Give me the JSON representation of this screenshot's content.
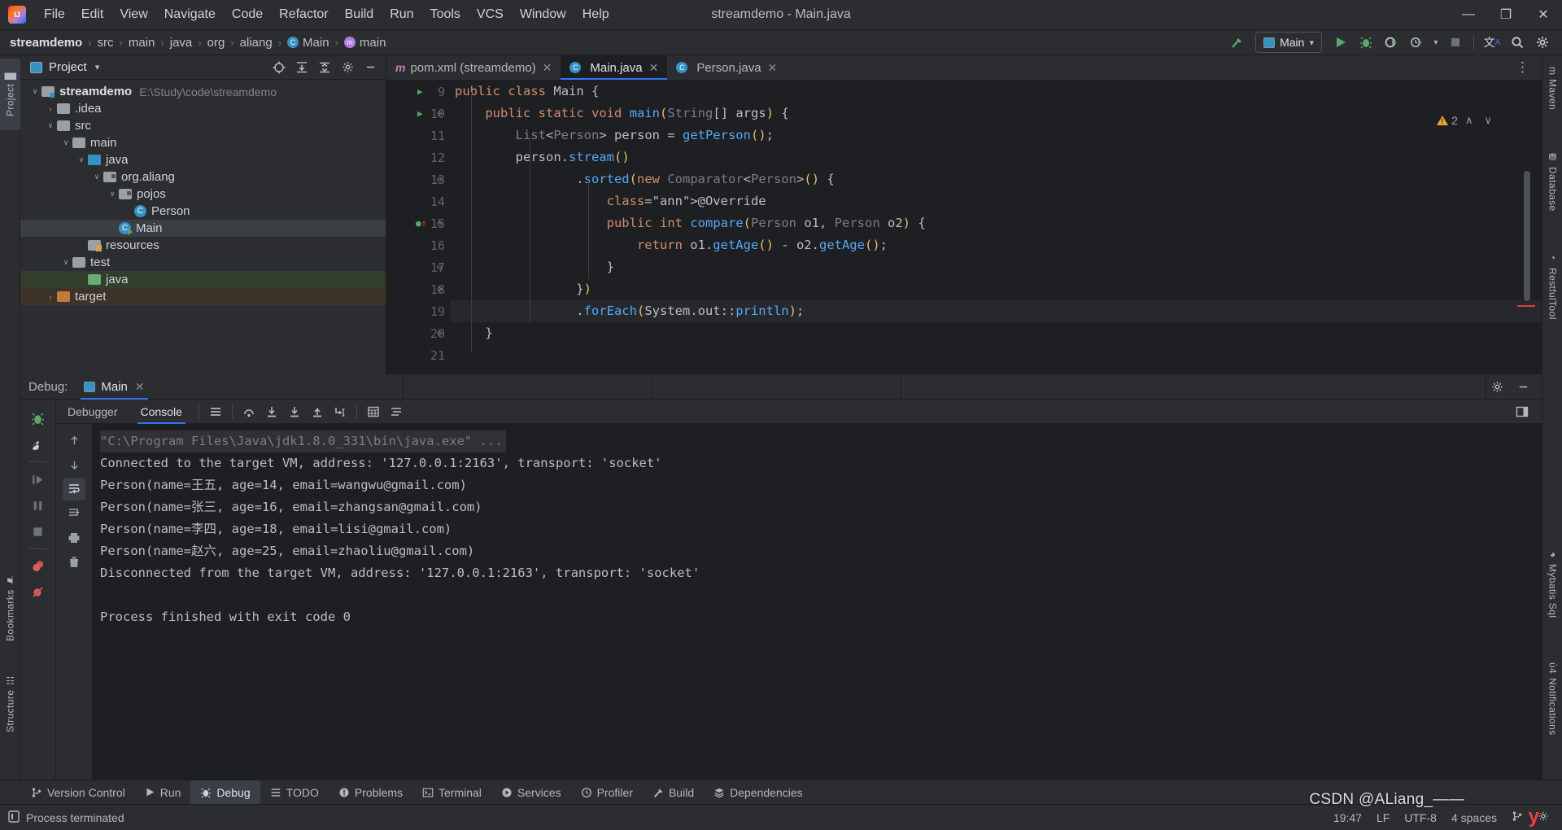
{
  "titlebar": {
    "logo_icon": "intellij-idea-logo",
    "window_title": "streamdemo - Main.java",
    "menus": [
      {
        "label": "File"
      },
      {
        "label": "Edit"
      },
      {
        "label": "View"
      },
      {
        "label": "Navigate"
      },
      {
        "label": "Code"
      },
      {
        "label": "Refactor"
      },
      {
        "label": "Build"
      },
      {
        "label": "Run"
      },
      {
        "label": "Tools"
      },
      {
        "label": "VCS"
      },
      {
        "label": "Window"
      },
      {
        "label": "Help"
      }
    ],
    "window_controls": {
      "minimize": "—",
      "maximize": "❐",
      "close": "✕"
    }
  },
  "navbar": {
    "breadcrumbs": [
      {
        "label": "streamdemo",
        "icon": null
      },
      {
        "label": "src",
        "icon": null
      },
      {
        "label": "main",
        "icon": null
      },
      {
        "label": "java",
        "icon": null
      },
      {
        "label": "org",
        "icon": null
      },
      {
        "label": "aliang",
        "icon": null
      },
      {
        "label": "Main",
        "icon": "class-icon"
      },
      {
        "label": "main",
        "icon": "method-icon"
      }
    ],
    "separator": "›",
    "run_config": {
      "label": "Main",
      "icon": "run-config-icon",
      "chevron": "▾"
    },
    "actions": [
      {
        "name": "build-hammer-icon",
        "glyph": "⬉"
      },
      {
        "name": "run-button",
        "glyph": "▶"
      },
      {
        "name": "debug-button",
        "glyph": "☢"
      },
      {
        "name": "run-with-coverage-button",
        "glyph": "◑"
      },
      {
        "name": "profiler-button",
        "glyph": "⏱"
      },
      {
        "name": "dropdown-chevron-icon",
        "glyph": "▾"
      },
      {
        "name": "stop-button",
        "glyph": "■"
      },
      {
        "name": "translate-icon",
        "glyph": "文"
      },
      {
        "name": "search-everywhere-icon",
        "glyph": "⚲"
      },
      {
        "name": "settings-gear-icon",
        "glyph": "⚙"
      }
    ]
  },
  "left_strip": [
    {
      "label": "Project",
      "glyph": "█",
      "active": true
    },
    {
      "label": "Bookmarks",
      "glyph": "⚑",
      "active": false
    },
    {
      "label": "Structure",
      "glyph": "☷",
      "active": false
    }
  ],
  "right_strip": [
    {
      "label": "Maven",
      "glyph": "m"
    },
    {
      "label": "Database",
      "glyph": "⛃"
    },
    {
      "label": "RestfulTool",
      "glyph": "◔"
    },
    {
      "label": "Mybatis Sql",
      "glyph": "◕"
    },
    {
      "label": "Notifications",
      "glyph": "ὑ4"
    }
  ],
  "project_panel": {
    "title": "Project",
    "dropdown_chevron": "▾",
    "actions": [
      {
        "name": "select-opened-file-icon",
        "glyph": "⌖"
      },
      {
        "name": "expand-all-icon",
        "glyph": "⩛"
      },
      {
        "name": "collapse-all-icon",
        "glyph": "⩚"
      },
      {
        "name": "panel-settings-icon",
        "glyph": "⚙"
      },
      {
        "name": "hide-panel-icon",
        "glyph": "—"
      }
    ],
    "tree": [
      {
        "depth": 0,
        "arrow": "∨",
        "icon": "module-folder-icon",
        "label": "streamdemo",
        "bold": true,
        "path": "E:\\Study\\code\\streamdemo",
        "state": "normal"
      },
      {
        "depth": 1,
        "arrow": "›",
        "icon": "folder-icon",
        "label": ".idea",
        "bold": false,
        "path": "",
        "state": "normal"
      },
      {
        "depth": 1,
        "arrow": "∨",
        "icon": "folder-icon",
        "label": "src",
        "bold": false,
        "path": "",
        "state": "normal"
      },
      {
        "depth": 2,
        "arrow": "∨",
        "icon": "folder-icon",
        "label": "main",
        "bold": false,
        "path": "",
        "state": "normal"
      },
      {
        "depth": 3,
        "arrow": "∨",
        "icon": "source-folder-icon",
        "label": "java",
        "bold": false,
        "path": "",
        "state": "normal"
      },
      {
        "depth": 4,
        "arrow": "∨",
        "icon": "package-icon",
        "label": "org.aliang",
        "bold": false,
        "path": "",
        "state": "normal"
      },
      {
        "depth": 5,
        "arrow": "∨",
        "icon": "package-icon",
        "label": "pojos",
        "bold": false,
        "path": "",
        "state": "normal"
      },
      {
        "depth": 6,
        "arrow": "",
        "icon": "class-icon",
        "label": "Person",
        "bold": false,
        "path": "",
        "state": "normal"
      },
      {
        "depth": 5,
        "arrow": "",
        "icon": "runnable-class-icon",
        "label": "Main",
        "bold": false,
        "path": "",
        "state": "selected"
      },
      {
        "depth": 3,
        "arrow": "",
        "icon": "resources-folder-icon",
        "label": "resources",
        "bold": false,
        "path": "",
        "state": "normal"
      },
      {
        "depth": 2,
        "arrow": "∨",
        "icon": "folder-icon",
        "label": "test",
        "bold": false,
        "path": "",
        "state": "normal"
      },
      {
        "depth": 3,
        "arrow": "",
        "icon": "test-source-folder-icon",
        "label": "java",
        "bold": false,
        "path": "",
        "state": "test"
      },
      {
        "depth": 1,
        "arrow": "›",
        "icon": "excluded-folder-icon",
        "label": "target",
        "bold": false,
        "path": "",
        "state": "excluded"
      }
    ]
  },
  "editor": {
    "tabs": [
      {
        "label": "pom.xml (streamdemo)",
        "icon": "maven-icon",
        "active": false,
        "close": "✕"
      },
      {
        "label": "Main.java",
        "icon": "class-icon",
        "active": true,
        "close": "✕"
      },
      {
        "label": "Person.java",
        "icon": "class-icon",
        "active": false,
        "close": "✕"
      }
    ],
    "kebab_icon": "⋮",
    "warning_count": "2",
    "warning_up_chevron": "∧",
    "warning_down_chevron": "∨",
    "first_line_number": 9,
    "current_line": 19,
    "lines": [
      {
        "num": 9,
        "text": "public class Main {",
        "gutter_run": "▶",
        "gutter_fold": "",
        "gutter_mark": ""
      },
      {
        "num": 10,
        "text": "    public static void main(String[] args) {",
        "gutter_run": "▶",
        "gutter_fold": "⊖",
        "gutter_mark": ""
      },
      {
        "num": 11,
        "text": "        List<Person> person = getPerson();",
        "gutter_run": "",
        "gutter_fold": "",
        "gutter_mark": ""
      },
      {
        "num": 12,
        "text": "        person.stream()",
        "gutter_run": "",
        "gutter_fold": "",
        "gutter_mark": ""
      },
      {
        "num": 13,
        "text": "                .sorted(new Comparator<Person>() {",
        "gutter_run": "",
        "gutter_fold": "⊖",
        "gutter_mark": ""
      },
      {
        "num": 14,
        "text": "                    @Override",
        "gutter_run": "",
        "gutter_fold": "",
        "gutter_mark": ""
      },
      {
        "num": 15,
        "text": "                    public int compare(Person o1, Person o2) {",
        "gutter_run": "",
        "gutter_fold": "⊖",
        "gutter_mark": "override-marker"
      },
      {
        "num": 16,
        "text": "                        return o1.getAge() - o2.getAge();",
        "gutter_run": "",
        "gutter_fold": "",
        "gutter_mark": ""
      },
      {
        "num": 17,
        "text": "                    }",
        "gutter_run": "",
        "gutter_fold": "⊖",
        "gutter_mark": ""
      },
      {
        "num": 18,
        "text": "                })",
        "gutter_run": "",
        "gutter_fold": "⊖",
        "gutter_mark": ""
      },
      {
        "num": 19,
        "text": "                .forEach(System.out::println);",
        "gutter_run": "",
        "gutter_fold": "",
        "gutter_mark": ""
      },
      {
        "num": 20,
        "text": "    }",
        "gutter_run": "",
        "gutter_fold": "⊖",
        "gutter_mark": ""
      },
      {
        "num": 21,
        "text": "",
        "gutter_run": "",
        "gutter_fold": "",
        "gutter_mark": ""
      }
    ]
  },
  "debug_window": {
    "label": "Debug:",
    "session_tab": {
      "label": "Main",
      "icon": "run-config-icon",
      "close": "✕"
    },
    "header_actions": [
      {
        "name": "debug-settings-icon",
        "glyph": "⚙"
      },
      {
        "name": "hide-debug-panel-icon",
        "glyph": "—"
      }
    ],
    "left_toolbar": [
      {
        "name": "debug-bug-icon",
        "glyph": "☢"
      },
      {
        "name": "debugger-settings-wrench-icon",
        "glyph": "ὒ7"
      },
      {
        "name": "resume-program-icon",
        "glyph": "⏵"
      },
      {
        "name": "pause-program-icon",
        "glyph": "⏸"
      },
      {
        "name": "stop-icon",
        "glyph": "■"
      },
      {
        "name": "view-breakpoints-icon",
        "glyph": "⬤"
      },
      {
        "name": "mute-breakpoints-icon",
        "glyph": "⬤"
      }
    ],
    "subtabs": [
      {
        "label": "Debugger",
        "active": false
      },
      {
        "label": "Console",
        "active": true
      }
    ],
    "subtab_icons": [
      {
        "name": "show-toolbar-icon",
        "glyph": "☰"
      },
      {
        "name": "step-over-icon",
        "glyph": "⤴"
      },
      {
        "name": "step-into-icon",
        "glyph": "⬇"
      },
      {
        "name": "force-step-into-icon",
        "glyph": "⬇"
      },
      {
        "name": "step-out-icon",
        "glyph": "⬆"
      },
      {
        "name": "run-to-cursor-icon",
        "glyph": "↳"
      },
      {
        "name": "evaluate-expression-icon",
        "glyph": "⊞"
      },
      {
        "name": "settings-list-icon",
        "glyph": "≣"
      }
    ],
    "subtabs_right_icon": {
      "name": "layout-settings-icon",
      "glyph": "▣"
    },
    "console_gutter": [
      {
        "name": "scroll-up-icon",
        "glyph": "↑"
      },
      {
        "name": "scroll-down-icon",
        "glyph": "↓"
      },
      {
        "name": "soft-wrap-icon",
        "glyph": "↵",
        "active": true
      },
      {
        "name": "scroll-to-end-icon",
        "glyph": "↧"
      },
      {
        "name": "print-icon",
        "glyph": "⎙"
      },
      {
        "name": "clear-all-icon",
        "glyph": "Ὕ1"
      }
    ],
    "console_output": [
      {
        "text": "\"C:\\Program Files\\Java\\jdk1.8.0_331\\bin\\java.exe\" ...",
        "style": "cmd"
      },
      {
        "text": "Connected to the target VM, address: '127.0.0.1:2163', transport: 'socket'",
        "style": "sys"
      },
      {
        "text": "Person(name=王五, age=14, email=wangwu@gmail.com)",
        "style": "sys"
      },
      {
        "text": "Person(name=张三, age=16, email=zhangsan@gmail.com)",
        "style": "sys"
      },
      {
        "text": "Person(name=李四, age=18, email=lisi@gmail.com)",
        "style": "sys"
      },
      {
        "text": "Person(name=赵六, age=25, email=zhaoliu@gmail.com)",
        "style": "sys"
      },
      {
        "text": "Disconnected from the target VM, address: '127.0.0.1:2163', transport: 'socket'",
        "style": "sys"
      },
      {
        "text": "",
        "style": "sys"
      },
      {
        "text": "Process finished with exit code 0",
        "style": "sys"
      }
    ]
  },
  "bottom_tools": [
    {
      "label": "Version Control",
      "glyph": "⑂",
      "active": false
    },
    {
      "label": "Run",
      "glyph": "▶",
      "active": false
    },
    {
      "label": "Debug",
      "glyph": "☢",
      "active": true
    },
    {
      "label": "TODO",
      "glyph": "☰",
      "active": false
    },
    {
      "label": "Problems",
      "glyph": "Ⓘ",
      "active": false
    },
    {
      "label": "Terminal",
      "glyph": "⌨",
      "active": false
    },
    {
      "label": "Services",
      "glyph": "▷",
      "active": false
    },
    {
      "label": "Profiler",
      "glyph": "⏱",
      "active": false
    },
    {
      "label": "Build",
      "glyph": "⬉",
      "active": false
    },
    {
      "label": "Dependencies",
      "glyph": "≣",
      "active": false
    }
  ],
  "statusbar": {
    "process_icon": "terminated-process-icon",
    "message": "Process terminated",
    "time": "19:47",
    "line_separator": "LF",
    "encoding": "UTF-8",
    "indent": "4 spaces",
    "right_icons": [
      {
        "name": "branch-icon",
        "glyph": "⑂"
      },
      {
        "name": "inspection-gear-icon",
        "glyph": "⚙"
      }
    ]
  },
  "watermark": {
    "text": "CSDN @ALiang_——",
    "red_glyph": "y"
  },
  "colors": {
    "accent_blue": "#3574f0",
    "bg_panel": "#2b2d30",
    "bg_editor": "#1e1f22",
    "text_primary": "#dfe1e5",
    "text_muted": "#7a7e85",
    "warning_orange": "#f0a732",
    "run_green": "#59a869",
    "keyword_orange": "#cf8e6d",
    "method_blue": "#56a8f5",
    "string_green": "#6aab73",
    "annotation_yellow": "#b3ae60"
  }
}
